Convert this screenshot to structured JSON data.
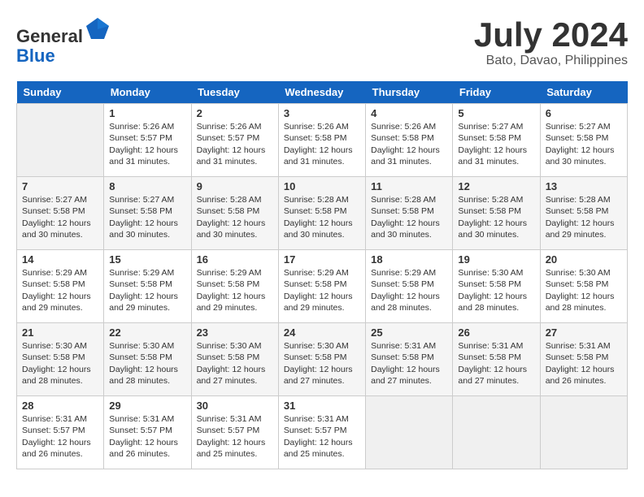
{
  "header": {
    "logo_line1": "General",
    "logo_line2": "Blue",
    "month_title": "July 2024",
    "location": "Bato, Davao, Philippines"
  },
  "weekdays": [
    "Sunday",
    "Monday",
    "Tuesday",
    "Wednesday",
    "Thursday",
    "Friday",
    "Saturday"
  ],
  "weeks": [
    [
      {
        "day": "",
        "info": ""
      },
      {
        "day": "1",
        "info": "Sunrise: 5:26 AM\nSunset: 5:57 PM\nDaylight: 12 hours\nand 31 minutes."
      },
      {
        "day": "2",
        "info": "Sunrise: 5:26 AM\nSunset: 5:57 PM\nDaylight: 12 hours\nand 31 minutes."
      },
      {
        "day": "3",
        "info": "Sunrise: 5:26 AM\nSunset: 5:58 PM\nDaylight: 12 hours\nand 31 minutes."
      },
      {
        "day": "4",
        "info": "Sunrise: 5:26 AM\nSunset: 5:58 PM\nDaylight: 12 hours\nand 31 minutes."
      },
      {
        "day": "5",
        "info": "Sunrise: 5:27 AM\nSunset: 5:58 PM\nDaylight: 12 hours\nand 31 minutes."
      },
      {
        "day": "6",
        "info": "Sunrise: 5:27 AM\nSunset: 5:58 PM\nDaylight: 12 hours\nand 30 minutes."
      }
    ],
    [
      {
        "day": "7",
        "info": "Sunrise: 5:27 AM\nSunset: 5:58 PM\nDaylight: 12 hours\nand 30 minutes."
      },
      {
        "day": "8",
        "info": "Sunrise: 5:27 AM\nSunset: 5:58 PM\nDaylight: 12 hours\nand 30 minutes."
      },
      {
        "day": "9",
        "info": "Sunrise: 5:28 AM\nSunset: 5:58 PM\nDaylight: 12 hours\nand 30 minutes."
      },
      {
        "day": "10",
        "info": "Sunrise: 5:28 AM\nSunset: 5:58 PM\nDaylight: 12 hours\nand 30 minutes."
      },
      {
        "day": "11",
        "info": "Sunrise: 5:28 AM\nSunset: 5:58 PM\nDaylight: 12 hours\nand 30 minutes."
      },
      {
        "day": "12",
        "info": "Sunrise: 5:28 AM\nSunset: 5:58 PM\nDaylight: 12 hours\nand 30 minutes."
      },
      {
        "day": "13",
        "info": "Sunrise: 5:28 AM\nSunset: 5:58 PM\nDaylight: 12 hours\nand 29 minutes."
      }
    ],
    [
      {
        "day": "14",
        "info": "Sunrise: 5:29 AM\nSunset: 5:58 PM\nDaylight: 12 hours\nand 29 minutes."
      },
      {
        "day": "15",
        "info": "Sunrise: 5:29 AM\nSunset: 5:58 PM\nDaylight: 12 hours\nand 29 minutes."
      },
      {
        "day": "16",
        "info": "Sunrise: 5:29 AM\nSunset: 5:58 PM\nDaylight: 12 hours\nand 29 minutes."
      },
      {
        "day": "17",
        "info": "Sunrise: 5:29 AM\nSunset: 5:58 PM\nDaylight: 12 hours\nand 29 minutes."
      },
      {
        "day": "18",
        "info": "Sunrise: 5:29 AM\nSunset: 5:58 PM\nDaylight: 12 hours\nand 28 minutes."
      },
      {
        "day": "19",
        "info": "Sunrise: 5:30 AM\nSunset: 5:58 PM\nDaylight: 12 hours\nand 28 minutes."
      },
      {
        "day": "20",
        "info": "Sunrise: 5:30 AM\nSunset: 5:58 PM\nDaylight: 12 hours\nand 28 minutes."
      }
    ],
    [
      {
        "day": "21",
        "info": "Sunrise: 5:30 AM\nSunset: 5:58 PM\nDaylight: 12 hours\nand 28 minutes."
      },
      {
        "day": "22",
        "info": "Sunrise: 5:30 AM\nSunset: 5:58 PM\nDaylight: 12 hours\nand 28 minutes."
      },
      {
        "day": "23",
        "info": "Sunrise: 5:30 AM\nSunset: 5:58 PM\nDaylight: 12 hours\nand 27 minutes."
      },
      {
        "day": "24",
        "info": "Sunrise: 5:30 AM\nSunset: 5:58 PM\nDaylight: 12 hours\nand 27 minutes."
      },
      {
        "day": "25",
        "info": "Sunrise: 5:31 AM\nSunset: 5:58 PM\nDaylight: 12 hours\nand 27 minutes."
      },
      {
        "day": "26",
        "info": "Sunrise: 5:31 AM\nSunset: 5:58 PM\nDaylight: 12 hours\nand 27 minutes."
      },
      {
        "day": "27",
        "info": "Sunrise: 5:31 AM\nSunset: 5:58 PM\nDaylight: 12 hours\nand 26 minutes."
      }
    ],
    [
      {
        "day": "28",
        "info": "Sunrise: 5:31 AM\nSunset: 5:57 PM\nDaylight: 12 hours\nand 26 minutes."
      },
      {
        "day": "29",
        "info": "Sunrise: 5:31 AM\nSunset: 5:57 PM\nDaylight: 12 hours\nand 26 minutes."
      },
      {
        "day": "30",
        "info": "Sunrise: 5:31 AM\nSunset: 5:57 PM\nDaylight: 12 hours\nand 25 minutes."
      },
      {
        "day": "31",
        "info": "Sunrise: 5:31 AM\nSunset: 5:57 PM\nDaylight: 12 hours\nand 25 minutes."
      },
      {
        "day": "",
        "info": ""
      },
      {
        "day": "",
        "info": ""
      },
      {
        "day": "",
        "info": ""
      }
    ]
  ]
}
